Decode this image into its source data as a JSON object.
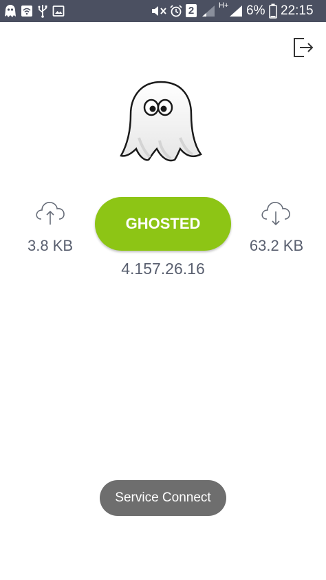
{
  "status_bar": {
    "battery_percent": "6%",
    "time": "22:15",
    "notification_badge": "2",
    "network_type": "H+",
    "left_icons": [
      "ghost-app-icon",
      "wifi-notification-icon",
      "usb-icon",
      "image-icon"
    ],
    "right_icons": [
      "mute-icon",
      "alarm-icon",
      "sim-badge-icon",
      "signal-icon",
      "signal-icon",
      "battery-icon"
    ],
    "background_color": "#4b5061"
  },
  "main": {
    "button_label": "GHOSTED",
    "button_color": "#8dc515",
    "ip_address": "4.157.26.16",
    "upload": "3.8 KB",
    "download": "63.2 KB"
  },
  "toast": {
    "message": "Service Connect"
  },
  "icons": {
    "exit": "exit-icon",
    "ghost": "ghost-logo",
    "upload": "cloud-upload-icon",
    "download": "cloud-download-icon"
  }
}
